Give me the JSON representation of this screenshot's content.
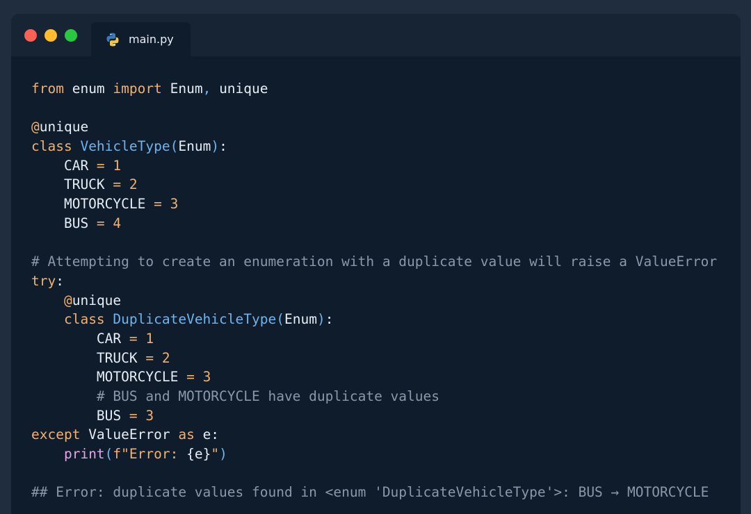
{
  "window": {
    "controls": [
      "close",
      "minimize",
      "maximize"
    ],
    "tab": {
      "label": "main.py",
      "icon": "python-icon"
    }
  },
  "colors": {
    "keyword": "#f2b16f",
    "class_name": "#6fb4ec",
    "comment": "#8a98ab",
    "builtin": "#dfa7e8",
    "text": "#e6edf5",
    "background": "#0f1c2b"
  },
  "code": {
    "lines": [
      [
        [
          "keyword",
          "from"
        ],
        [
          "name",
          " enum "
        ],
        [
          "keyword",
          "import"
        ],
        [
          "name",
          " Enum"
        ],
        [
          "punct",
          ","
        ],
        [
          "name",
          " unique"
        ]
      ],
      [],
      [
        [
          "decorator",
          "@"
        ],
        [
          "name",
          "unique"
        ]
      ],
      [
        [
          "keyword",
          "class"
        ],
        [
          "name",
          " "
        ],
        [
          "class",
          "VehicleType"
        ],
        [
          "punct",
          "("
        ],
        [
          "name",
          "Enum"
        ],
        [
          "punct",
          ")"
        ],
        [
          "name",
          ":"
        ]
      ],
      [
        [
          "name",
          "    CAR "
        ],
        [
          "op",
          "="
        ],
        [
          "name",
          " "
        ],
        [
          "number",
          "1"
        ]
      ],
      [
        [
          "name",
          "    TRUCK "
        ],
        [
          "op",
          "="
        ],
        [
          "name",
          " "
        ],
        [
          "number",
          "2"
        ]
      ],
      [
        [
          "name",
          "    MOTORCYCLE "
        ],
        [
          "op",
          "="
        ],
        [
          "name",
          " "
        ],
        [
          "number",
          "3"
        ]
      ],
      [
        [
          "name",
          "    BUS "
        ],
        [
          "op",
          "="
        ],
        [
          "name",
          " "
        ],
        [
          "number",
          "4"
        ]
      ],
      [],
      [
        [
          "comment",
          "# Attempting to create an enumeration with a duplicate value will raise a ValueError"
        ]
      ],
      [
        [
          "keyword",
          "try"
        ],
        [
          "name",
          ":"
        ]
      ],
      [
        [
          "name",
          "    "
        ],
        [
          "decorator",
          "@"
        ],
        [
          "name",
          "unique"
        ]
      ],
      [
        [
          "name",
          "    "
        ],
        [
          "keyword",
          "class"
        ],
        [
          "name",
          " "
        ],
        [
          "class",
          "DuplicateVehicleType"
        ],
        [
          "punct",
          "("
        ],
        [
          "name",
          "Enum"
        ],
        [
          "punct",
          ")"
        ],
        [
          "name",
          ":"
        ]
      ],
      [
        [
          "name",
          "        CAR "
        ],
        [
          "op",
          "="
        ],
        [
          "name",
          " "
        ],
        [
          "number",
          "1"
        ]
      ],
      [
        [
          "name",
          "        TRUCK "
        ],
        [
          "op",
          "="
        ],
        [
          "name",
          " "
        ],
        [
          "number",
          "2"
        ]
      ],
      [
        [
          "name",
          "        MOTORCYCLE "
        ],
        [
          "op",
          "="
        ],
        [
          "name",
          " "
        ],
        [
          "number",
          "3"
        ]
      ],
      [
        [
          "name",
          "        "
        ],
        [
          "comment",
          "# BUS and MOTORCYCLE have duplicate values"
        ]
      ],
      [
        [
          "name",
          "        BUS "
        ],
        [
          "op",
          "="
        ],
        [
          "name",
          " "
        ],
        [
          "number",
          "3"
        ]
      ],
      [
        [
          "keyword",
          "except"
        ],
        [
          "name",
          " ValueError "
        ],
        [
          "keyword",
          "as"
        ],
        [
          "name",
          " e:"
        ]
      ],
      [
        [
          "name",
          "    "
        ],
        [
          "builtin",
          "print"
        ],
        [
          "punct",
          "("
        ],
        [
          "string",
          "f\"Error: "
        ],
        [
          "name",
          "{e}"
        ],
        [
          "string",
          "\""
        ],
        [
          "punct",
          ")"
        ]
      ],
      [],
      [
        [
          "comment",
          "## Error: duplicate values found in <enum 'DuplicateVehicleType'>: BUS → MOTORCYCLE"
        ]
      ]
    ]
  }
}
